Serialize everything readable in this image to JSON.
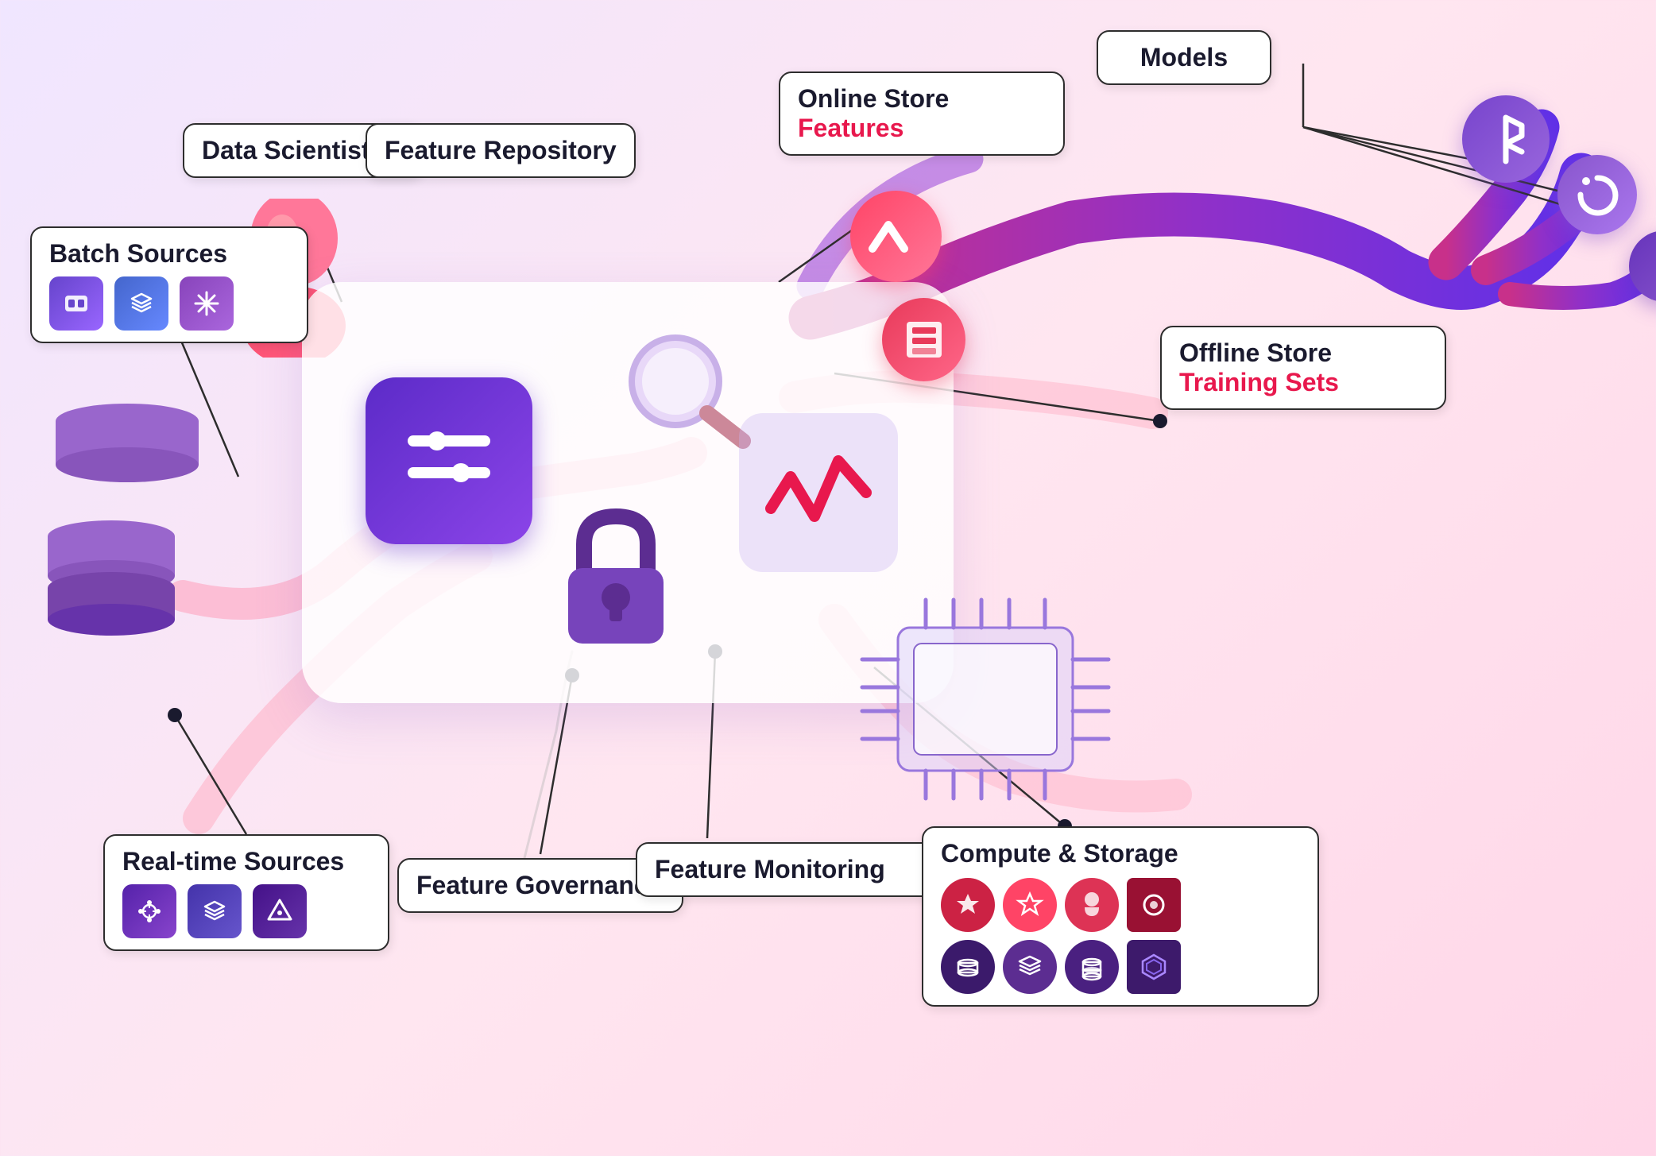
{
  "labels": {
    "batch_sources": {
      "title": "Batch Sources",
      "subtitle": null
    },
    "data_scientist": {
      "title": "Data Scientist",
      "subtitle": null
    },
    "feature_repo": {
      "title": "Feature Repository",
      "subtitle": null
    },
    "online_store": {
      "title": "Online Store",
      "subtitle": "Features"
    },
    "models": {
      "title": "Models",
      "subtitle": null
    },
    "offline_store": {
      "title": "Offline Store",
      "subtitle": "Training Sets"
    },
    "real_time": {
      "title": "Real-time Sources",
      "subtitle": null
    },
    "feature_gov": {
      "title": "Feature Governance",
      "subtitle": null
    },
    "feature_mon": {
      "title": "Feature Monitoring",
      "subtitle": null
    },
    "compute": {
      "title": "Compute & Storage",
      "subtitle": null
    }
  },
  "icons": {
    "batch_i1": "🔷",
    "batch_i2": "🗂",
    "batch_i3": "❄",
    "rt_i1": "⚙",
    "rt_i2": "📊",
    "rt_i3": "🔷"
  },
  "colors": {
    "accent_red": "#e8184d",
    "accent_purple": "#6c3bc5",
    "bg_gradient_start": "#f0e6ff",
    "bg_gradient_end": "#ffd6e8",
    "label_border": "#2d2d2d",
    "label_bg": "#ffffff",
    "dot_color": "#1a1a2e"
  }
}
